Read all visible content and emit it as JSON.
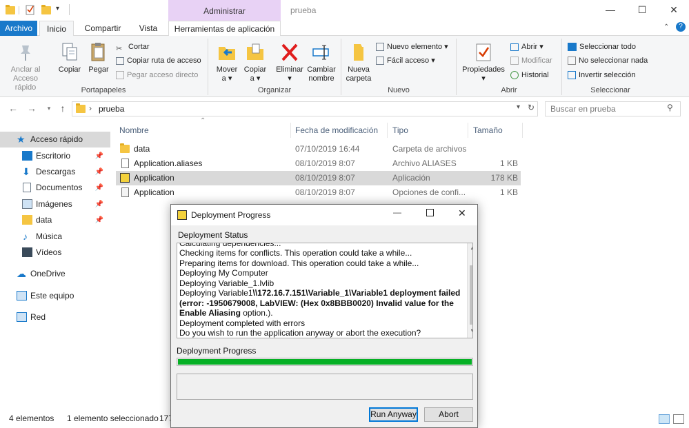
{
  "title_bar": {
    "context_tab": "Administrar",
    "window_title": "prueba",
    "quick_access": [
      "folder-icon",
      "properties-icon",
      "new-folder-icon",
      "customize-icon"
    ]
  },
  "tabs": [
    {
      "label": "Archivo",
      "active": false
    },
    {
      "label": "Inicio",
      "active": true
    },
    {
      "label": "Compartir",
      "active": false
    },
    {
      "label": "Vista",
      "active": false
    },
    {
      "label": "Herramientas de aplicación",
      "active": false
    }
  ],
  "ribbon": {
    "portapapeles": {
      "group_label": "Portapapeles",
      "pin_label_1": "Anclar al",
      "pin_label_2": "Acceso rápido",
      "copy": "Copiar",
      "paste": "Pegar",
      "cut": "Cortar",
      "copy_path": "Copiar ruta de acceso",
      "paste_shortcut": "Pegar acceso directo"
    },
    "organizar": {
      "group_label": "Organizar",
      "move_1": "Mover",
      "move_2": "a ▾",
      "copy_1": "Copiar",
      "copy_2": "a ▾",
      "delete_1": "Eliminar",
      "delete_2": "▾",
      "rename_1": "Cambiar",
      "rename_2": "nombre"
    },
    "nuevo": {
      "group_label": "Nuevo",
      "new_folder_1": "Nueva",
      "new_folder_2": "carpeta",
      "new_item": "Nuevo elemento ▾",
      "easy_access": "Fácil acceso ▾"
    },
    "abrir": {
      "group_label": "Abrir",
      "properties_1": "Propiedades",
      "properties_2": "▾",
      "open": "Abrir ▾",
      "edit": "Modificar",
      "history": "Historial"
    },
    "seleccionar": {
      "group_label": "Seleccionar",
      "select_all": "Seleccionar todo",
      "select_none": "No seleccionar nada",
      "invert": "Invertir selección"
    }
  },
  "address": {
    "path": "prueba",
    "search_placeholder": "Buscar en prueba"
  },
  "sidebar": {
    "items": [
      {
        "label": "Acceso rápido",
        "icon": "star-icon",
        "pinned": false
      },
      {
        "label": "Escritorio",
        "icon": "desktop-icon",
        "pinned": true
      },
      {
        "label": "Descargas",
        "icon": "download-icon",
        "pinned": true
      },
      {
        "label": "Documentos",
        "icon": "documents-icon",
        "pinned": true
      },
      {
        "label": "Imágenes",
        "icon": "pictures-icon",
        "pinned": true
      },
      {
        "label": "data",
        "icon": "folder-icon",
        "pinned": true
      },
      {
        "label": "Música",
        "icon": "music-icon",
        "pinned": false
      },
      {
        "label": "Vídeos",
        "icon": "videos-icon",
        "pinned": false
      },
      {
        "label": "OneDrive",
        "icon": "cloud-icon",
        "pinned": false
      },
      {
        "label": "Este equipo",
        "icon": "computer-icon",
        "pinned": false
      },
      {
        "label": "Red",
        "icon": "network-icon",
        "pinned": false
      }
    ]
  },
  "file_list": {
    "columns": [
      "Nombre",
      "Fecha de modificación",
      "Tipo",
      "Tamaño"
    ],
    "rows": [
      {
        "name": "data",
        "date": "07/10/2019 16:44",
        "type": "Carpeta de archivos",
        "size": "",
        "icon": "folder-icon",
        "selected": false
      },
      {
        "name": "Application.aliases",
        "date": "08/10/2019 8:07",
        "type": "Archivo ALIASES",
        "size": "1 KB",
        "icon": "file-icon",
        "selected": false
      },
      {
        "name": "Application",
        "date": "08/10/2019 8:07",
        "type": "Aplicación",
        "size": "178 KB",
        "icon": "labview-app-icon",
        "selected": true
      },
      {
        "name": "Application",
        "date": "08/10/2019 8:07",
        "type": "Opciones de confi...",
        "size": "1 KB",
        "icon": "config-file-icon",
        "selected": false
      }
    ]
  },
  "status_bar": {
    "count": "4 elementos",
    "selection": "1 elemento seleccionado",
    "selection_size": "177"
  },
  "dialog": {
    "title": "Deployment Progress",
    "status_label": "Deployment Status",
    "log_partial": "Calculating dependencies...",
    "log": [
      "Checking items for conflicts. This operation could take a while...",
      "Preparing items for download. This operation could take a while...",
      "Deploying My Computer",
      "Deploying Variable_1.lvlib"
    ],
    "error_prefix": "Deploying Variable1",
    "error_bold_1": "\\\\172.16.7.151\\Variable_1\\Variable1 deployment failed",
    "error_bold_2": "(error: -1950679008, LabVIEW:  (Hex 0x8BBB0020) Invalid value for the",
    "error_bold_3": "Enable Aliasing",
    "error_suffix": " option.).",
    "log_after": [
      "Deployment completed with errors",
      "Do you wish to run the application anyway or abort the execution?"
    ],
    "progress_label": "Deployment Progress",
    "progress_fraction": 1.0,
    "progress_color": "#06b025",
    "buttons": {
      "run": "Run Anyway",
      "abort": "Abort"
    }
  },
  "colors": {
    "archivo_tab": "#1979ca",
    "context_tab": "#e8d2f5",
    "selected_row": "#d9d9d9"
  }
}
